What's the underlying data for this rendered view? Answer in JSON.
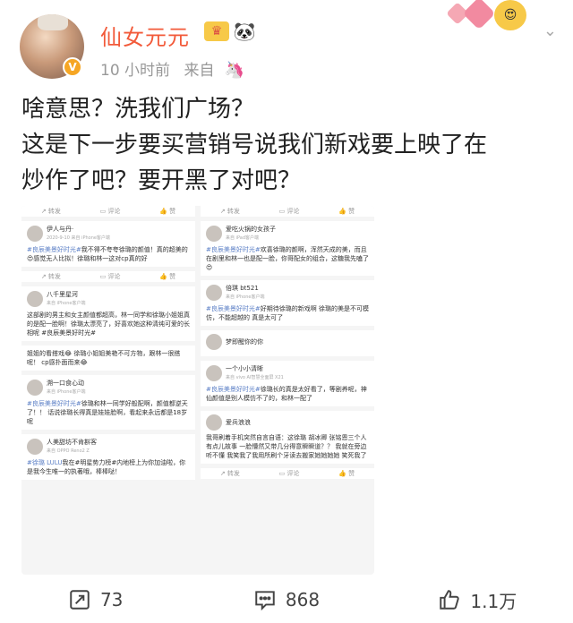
{
  "header": {
    "username": "仙女元元",
    "time": "10 小时前",
    "source_prefix": "来自",
    "verified_icon": "v-badge-icon",
    "crown_icon": "crown-icon",
    "panda_icon": "panda-icon",
    "source_icon": "unicorn-icon",
    "menu_icon": "chevron-down-icon",
    "colors": {
      "username": "#f25a3a",
      "meta": "#999999"
    }
  },
  "post": {
    "line1": "啥意思？洗我们广场？",
    "line2": "这是下一步要买营销号说我们新戏要上映了在",
    "line3": "炒作了吧？要开黑了对吧？"
  },
  "embedded_screenshot": {
    "left": [
      {
        "type": "actions",
        "a": "转发",
        "b": "评论",
        "c": "赞"
      },
      {
        "type": "card",
        "name": "伊人与丹·",
        "sub": "2020-9-10 来自 iPhone客户端",
        "text_tag": "#良辰美景好时光#",
        "text": "我不得不夸夸徐璐的颜值！真的超美的😍感觉无人比拟！徐璐和林一这对cp真的好"
      },
      {
        "type": "actions",
        "a": "转发",
        "b": "评论",
        "c": "赞"
      },
      {
        "type": "card",
        "name": "八千里星河",
        "sub": "来自 iPhone客户端",
        "text_tag": "",
        "text": "这部剧的男主和女主颜值都超高，林一同学和徐璐小姐姐真的是配一脸啊！徐璐太漂亮了，好喜欢她这种清纯可爱的长相呢 #良辰美景好时光#"
      },
      {
        "type": "card",
        "name": "",
        "sub": "",
        "text_tag": "",
        "text": "姐姐的看搭戏😂 徐璐小姐姐美艳不可方物，跟林一很搭呢！ cp感扑面而来😂"
      },
      {
        "type": "card",
        "name": "溯一口食心动",
        "sub": "来自 iPhone客户端",
        "text_tag": "#良辰美景好时光#",
        "text": "徐璐和林一同学好般配啊，颜值都逆天了！！ 话说徐璐长得真是娃娃脸啊，看起来永远都是18岁呢"
      },
      {
        "type": "card",
        "name": "人美甜坊不肯斟客",
        "sub": "来自 OPPO Reno2 Z",
        "text_tag": "#徐璐 LULU",
        "text": "我在#明星势力榜#内地榜上为你加油啦，你是我今生唯一的执著哦，棒棒哒！"
      }
    ],
    "right": [
      {
        "type": "actions",
        "a": "转发",
        "b": "评论",
        "c": "赞"
      },
      {
        "type": "card",
        "name": "爱吃火锅的女孩子",
        "sub": "来自 iPad客户端",
        "text_tag": "#良辰美景好时光#",
        "text": "欢喜徐璐的颜啊，浑然天成的美，而且在剧里和林一也是配一脸，你哥配女的组合，这糖我先嗑了😍"
      },
      {
        "type": "card",
        "name": "倍琪 bt521",
        "sub": "来自 iPhone客户端",
        "text_tag": "#良辰美景好时光#",
        "text": "好期待徐璐的新戏啊 徐璐的美是不可模仿，不能超越的 真是太可了"
      },
      {
        "type": "card",
        "name": "梦即醒你的你",
        "sub": "",
        "text_tag": "",
        "text": ""
      },
      {
        "type": "card",
        "name": "一个小小清晰",
        "sub": "来自 vivo AI智慧全面屏 X21",
        "text_tag": "#良辰美景好时光#",
        "text": "徐璐长的真是太好看了，等剧养呢，神仙颜值是别人模仿不了的，和林一配了"
      },
      {
        "type": "card",
        "name": "爱兵浪浪",
        "sub": "",
        "text_tag": "",
        "text": "我哥刷着手机突然自言自语：这徐璐 胡冰卿 张铭恩三个人有点儿故事 一脸懵然又带几分得意瞬瞬道？？ 我就在旁边听不懂 我笑我了我用所刷个牙读去搬家她她她她 笑死我了"
      },
      {
        "type": "actions",
        "a": "转发",
        "b": "评论",
        "c": "赞"
      }
    ]
  },
  "actions": {
    "repost": {
      "icon": "repost-icon",
      "count": "73"
    },
    "comment": {
      "icon": "comment-icon",
      "count": "868"
    },
    "like": {
      "icon": "like-icon",
      "count": "1.1万"
    }
  }
}
